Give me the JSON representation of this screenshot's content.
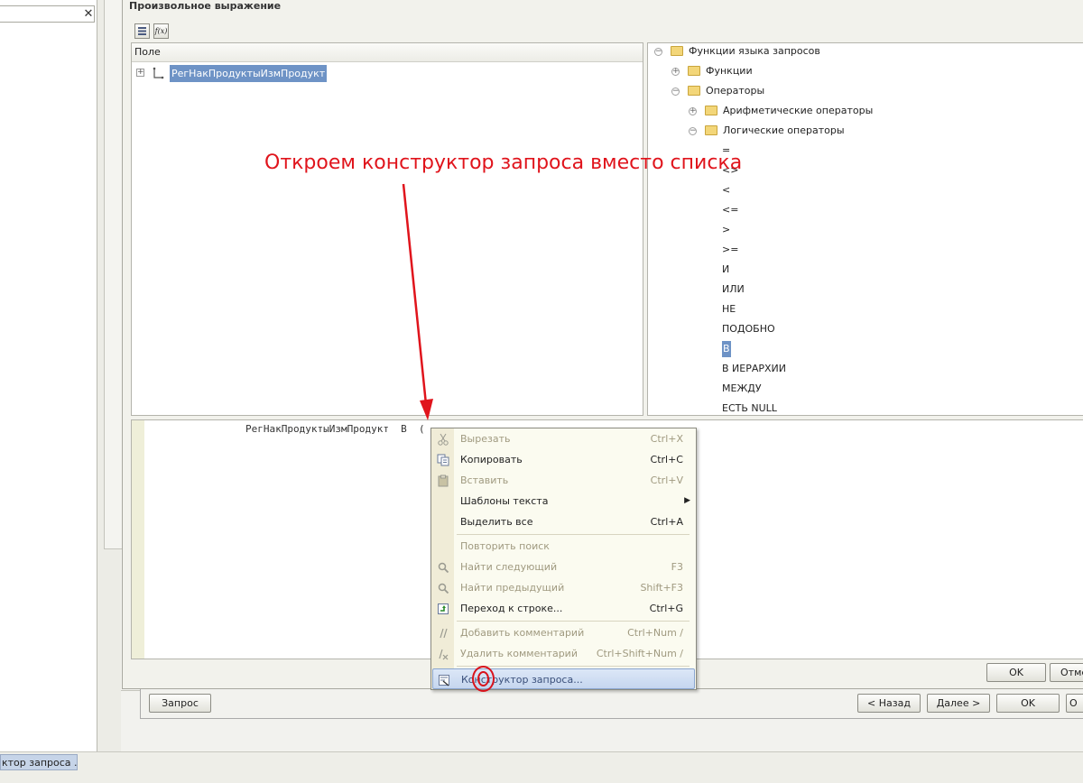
{
  "background": {
    "taskbar_item": "ктор запроса ..."
  },
  "dialog": {
    "title": "Произвольное выражение",
    "toolbar": {
      "list_icon": "list-icon",
      "fx_label": "f(x)"
    },
    "fields": {
      "header": "Поле",
      "items": [
        {
          "expander": "+",
          "name": "РегНакПродуктыИзмПродукт"
        }
      ]
    },
    "functions_tree": {
      "root": "Функции языка запросов",
      "functions": "Функции",
      "operators": "Операторы",
      "arithmetic": "Арифметические операторы",
      "logical": "Логические операторы",
      "logical_items": [
        "=",
        "<>",
        "<",
        "<=",
        ">",
        ">=",
        "И",
        "ИЛИ",
        "НЕ",
        "ПОДОБНО",
        "В",
        "В ИЕРАРХИИ",
        "МЕЖДУ",
        "ЕСТЬ NULL"
      ],
      "selected": "В"
    },
    "editor": {
      "text": "РегНакПродуктыИзмПродукт  В  ("
    },
    "ok_label": "OK",
    "cancel_label": "Отме"
  },
  "annotation": {
    "text": "Откроем конструктор запроса вместо списка",
    "color": "#e0141c"
  },
  "context_menu": {
    "items": [
      {
        "label": "Вырезать",
        "shortcut": "Ctrl+X",
        "icon": "scissors-icon",
        "disabled": true
      },
      {
        "label": "Копировать",
        "shortcut": "Ctrl+C",
        "icon": "copy-icon",
        "disabled": false
      },
      {
        "label": "Вставить",
        "shortcut": "Ctrl+V",
        "icon": "paste-icon",
        "disabled": true
      },
      {
        "label": "Шаблоны текста",
        "shortcut": "",
        "icon": "",
        "disabled": false,
        "submenu": "▶"
      },
      {
        "label": "Выделить все",
        "shortcut": "Ctrl+A",
        "icon": "",
        "disabled": false
      },
      {
        "label": "Повторить поиск",
        "shortcut": "",
        "icon": "",
        "disabled": true
      },
      {
        "label": "Найти следующий",
        "shortcut": "F3",
        "icon": "find-next-icon",
        "disabled": true
      },
      {
        "label": "Найти предыдущий",
        "shortcut": "Shift+F3",
        "icon": "find-prev-icon",
        "disabled": true
      },
      {
        "label": "Переход к строке...",
        "shortcut": "Ctrl+G",
        "icon": "goto-line-icon",
        "disabled": false
      },
      {
        "label": "Добавить комментарий",
        "shortcut": "Ctrl+Num /",
        "icon": "comment-add-icon",
        "disabled": true
      },
      {
        "label": "Удалить комментарий",
        "shortcut": "Ctrl+Shift+Num /",
        "icon": "comment-remove-icon",
        "disabled": true
      },
      {
        "label": "Конструктор запроса...",
        "shortcut": "",
        "icon": "query-constructor-icon",
        "disabled": false
      }
    ]
  },
  "wizard_buttons": {
    "query": "Запрос",
    "back": "< Назад",
    "next": "Далее >",
    "ok": "OK",
    "cancel": "О"
  }
}
